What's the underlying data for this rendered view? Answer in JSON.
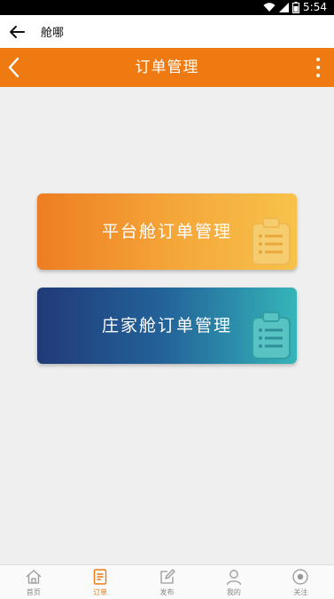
{
  "status_bar": {
    "time": "5:54"
  },
  "app_bar": {
    "title": "舱哪"
  },
  "header": {
    "title": "订单管理"
  },
  "cards": [
    {
      "label": "平台舱订单管理"
    },
    {
      "label": "庄家舱订单管理"
    }
  ],
  "bottom_nav": [
    {
      "label": "首页",
      "icon": "home-icon"
    },
    {
      "label": "订单",
      "icon": "order-icon",
      "active": true
    },
    {
      "label": "发布",
      "icon": "edit-icon"
    },
    {
      "label": "我的",
      "icon": "user-icon"
    },
    {
      "label": "关注",
      "icon": "eye-icon"
    }
  ],
  "colors": {
    "accent": "#ef7a12",
    "platform_card": [
      "#ee7d22",
      "#f7c24a"
    ],
    "dealer_card": [
      "#213a78",
      "#35b5b9"
    ]
  }
}
